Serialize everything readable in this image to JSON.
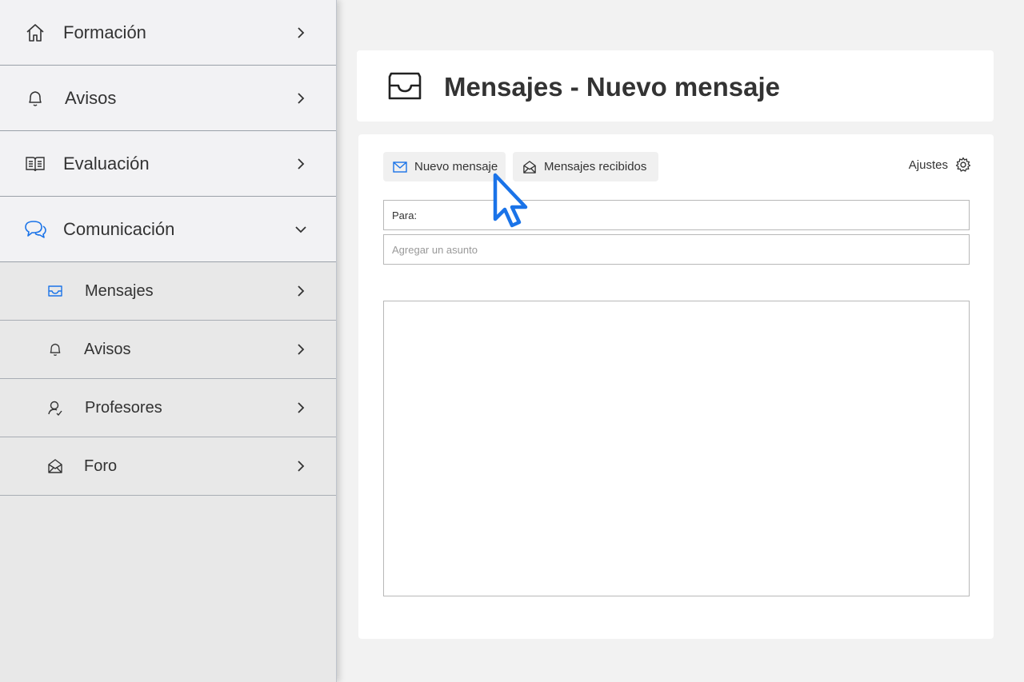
{
  "sidebar": {
    "main_items": [
      {
        "label": "Formación",
        "icon": "home-icon"
      },
      {
        "label": "Avisos",
        "icon": "bell-icon"
      },
      {
        "label": "Evaluación",
        "icon": "book-icon"
      },
      {
        "label": "Comunicación",
        "icon": "chat-bubbles-icon",
        "expanded": true
      }
    ],
    "sub_items": [
      {
        "label": "Mensajes",
        "icon": "inbox-icon",
        "active": true
      },
      {
        "label": "Avisos",
        "icon": "bell-icon"
      },
      {
        "label": "Profesores",
        "icon": "user-check-icon"
      },
      {
        "label": "Foro",
        "icon": "open-envelope-icon"
      }
    ]
  },
  "header": {
    "title": "Mensajes - Nuevo mensaje",
    "icon": "inbox-icon"
  },
  "toolbar": {
    "new_message_label": "Nuevo mensaje",
    "received_label": "Mensajes recibidos",
    "settings_label": "Ajustes"
  },
  "compose": {
    "to_label": "Para:",
    "subject_placeholder": "Agregar un asunto",
    "body_value": ""
  },
  "colors": {
    "accent": "#1a73e8",
    "sidebar_bg": "#e8e8e8",
    "sidebar_main_bg": "#f2f2f4",
    "page_bg": "#f2f2f2",
    "card_bg": "#ffffff"
  }
}
